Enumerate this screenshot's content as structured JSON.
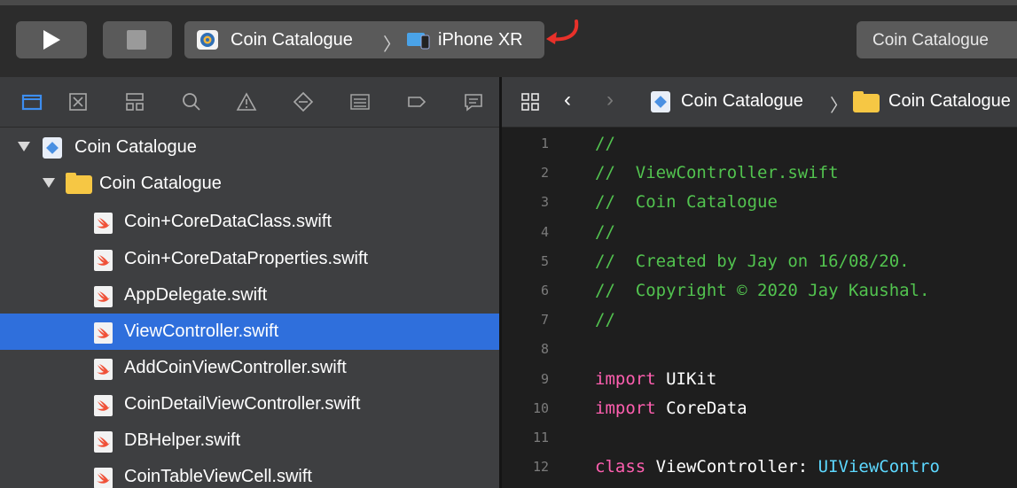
{
  "toolbar": {
    "scheme_app": "Coin Catalogue",
    "scheme_separator": "〉",
    "scheme_device": "iPhone XR",
    "activity_text": "Coin Catalogue"
  },
  "navigator": {
    "tabs": [
      "project-navigator",
      "source-control-navigator",
      "symbol-navigator",
      "find-navigator",
      "issue-navigator",
      "test-navigator",
      "debug-navigator",
      "breakpoint-navigator",
      "report-navigator"
    ],
    "project": "Coin Catalogue",
    "group": "Coin Catalogue",
    "files": [
      "Coin+CoreDataClass.swift",
      "Coin+CoreDataProperties.swift",
      "AppDelegate.swift",
      "ViewController.swift",
      "AddCoinViewController.swift",
      "CoinDetailViewController.swift",
      "DBHelper.swift",
      "CoinTableViewCell.swift"
    ],
    "selected_file": "ViewController.swift"
  },
  "jump_bar": {
    "project": "Coin Catalogue",
    "separator": "〉",
    "folder": "Coin Catalogue"
  },
  "code": {
    "lines": [
      {
        "n": "1",
        "parts": [
          {
            "t": "//",
            "k": "comment"
          }
        ]
      },
      {
        "n": "2",
        "parts": [
          {
            "t": "//  ViewController.swift",
            "k": "comment"
          }
        ]
      },
      {
        "n": "3",
        "parts": [
          {
            "t": "//  Coin Catalogue",
            "k": "comment"
          }
        ]
      },
      {
        "n": "4",
        "parts": [
          {
            "t": "//",
            "k": "comment"
          }
        ]
      },
      {
        "n": "5",
        "parts": [
          {
            "t": "//  Created by Jay on 16/08/20.",
            "k": "comment"
          }
        ]
      },
      {
        "n": "6",
        "parts": [
          {
            "t": "//  Copyright © 2020 Jay Kaushal.",
            "k": "comment"
          }
        ]
      },
      {
        "n": "7",
        "parts": [
          {
            "t": "//",
            "k": "comment"
          }
        ]
      },
      {
        "n": "8",
        "parts": []
      },
      {
        "n": "9",
        "parts": [
          {
            "t": "import",
            "k": "keyword"
          },
          {
            "t": " UIKit",
            "k": "plain"
          }
        ]
      },
      {
        "n": "10",
        "parts": [
          {
            "t": "import",
            "k": "keyword"
          },
          {
            "t": " CoreData",
            "k": "plain"
          }
        ]
      },
      {
        "n": "11",
        "parts": []
      },
      {
        "n": "12",
        "parts": [
          {
            "t": "class",
            "k": "keyword"
          },
          {
            "t": " ViewController: ",
            "k": "plain"
          },
          {
            "t": "UIViewContro",
            "k": "type"
          }
        ]
      }
    ]
  },
  "colors": {
    "selection": "#2f6fdc",
    "comment": "#52c34f",
    "keyword": "#ff5fb0",
    "type": "#5dd8ff",
    "annotation_arrow": "#e8312a"
  }
}
